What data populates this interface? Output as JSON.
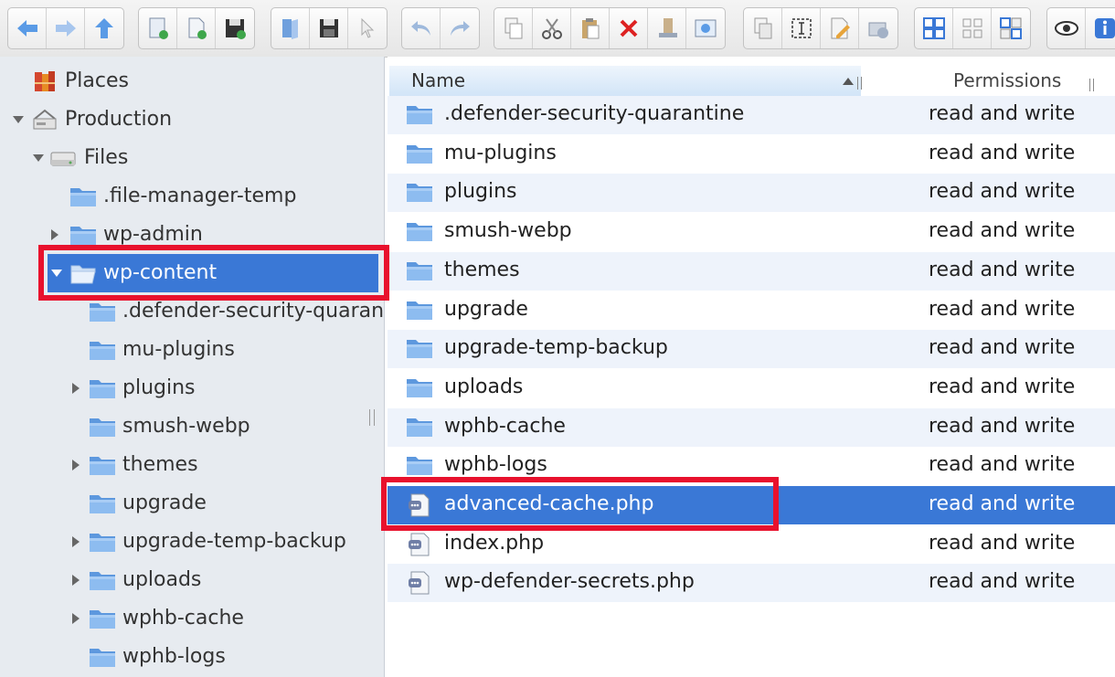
{
  "toolbar": {
    "groups": [
      [
        "back-icon",
        "forward-icon",
        "up-icon"
      ],
      [
        "new-folder-icon",
        "new-file-icon",
        "save-icon"
      ],
      [
        "open-icon",
        "disk-icon",
        "pointer-icon"
      ],
      [
        "undo-icon",
        "redo-icon"
      ],
      [
        "copy-icon",
        "cut-icon",
        "paste-icon",
        "delete-icon",
        "rename-icon",
        "edit-icon"
      ],
      [
        "duplicate-icon",
        "select-icon",
        "edit-text-icon",
        "permissions-icon"
      ],
      [
        "view-large-icon",
        "view-small-icon",
        "view-list-icon"
      ],
      [
        "preview-icon",
        "info-icon"
      ]
    ]
  },
  "sidebar": {
    "items": [
      {
        "label": "Places",
        "depth": 0,
        "arrow": "none",
        "icon": "places-icon"
      },
      {
        "label": "Production",
        "depth": 0,
        "arrow": "down",
        "icon": "server-icon"
      },
      {
        "label": "Files",
        "depth": 1,
        "arrow": "down",
        "icon": "drive-icon"
      },
      {
        "label": ".file-manager-temp",
        "depth": 2,
        "arrow": "none",
        "icon": "folder-icon"
      },
      {
        "label": "wp-admin",
        "depth": 2,
        "arrow": "right",
        "icon": "folder-icon"
      },
      {
        "label": "wp-content",
        "depth": 2,
        "arrow": "down",
        "icon": "open-folder-icon",
        "selected": true
      },
      {
        "label": ".defender-security-quarantine",
        "depth": 3,
        "arrow": "none",
        "icon": "folder-icon"
      },
      {
        "label": "mu-plugins",
        "depth": 3,
        "arrow": "none",
        "icon": "folder-icon"
      },
      {
        "label": "plugins",
        "depth": 3,
        "arrow": "right",
        "icon": "folder-icon"
      },
      {
        "label": "smush-webp",
        "depth": 3,
        "arrow": "none",
        "icon": "folder-icon"
      },
      {
        "label": "themes",
        "depth": 3,
        "arrow": "right",
        "icon": "folder-icon"
      },
      {
        "label": "upgrade",
        "depth": 3,
        "arrow": "none",
        "icon": "folder-icon"
      },
      {
        "label": "upgrade-temp-backup",
        "depth": 3,
        "arrow": "right",
        "icon": "folder-icon"
      },
      {
        "label": "uploads",
        "depth": 3,
        "arrow": "right",
        "icon": "folder-icon"
      },
      {
        "label": "wphb-cache",
        "depth": 3,
        "arrow": "right",
        "icon": "folder-icon"
      },
      {
        "label": "wphb-logs",
        "depth": 3,
        "arrow": "none",
        "icon": "folder-icon"
      }
    ]
  },
  "filelist": {
    "columns": {
      "name": "Name",
      "permissions": "Permissions"
    },
    "rows": [
      {
        "name": ".defender-security-quarantine",
        "perm": "read and write",
        "type": "folder"
      },
      {
        "name": "mu-plugins",
        "perm": "read and write",
        "type": "folder"
      },
      {
        "name": "plugins",
        "perm": "read and write",
        "type": "folder"
      },
      {
        "name": "smush-webp",
        "perm": "read and write",
        "type": "folder"
      },
      {
        "name": "themes",
        "perm": "read and write",
        "type": "folder"
      },
      {
        "name": "upgrade",
        "perm": "read and write",
        "type": "folder"
      },
      {
        "name": "upgrade-temp-backup",
        "perm": "read and write",
        "type": "folder"
      },
      {
        "name": "uploads",
        "perm": "read and write",
        "type": "folder"
      },
      {
        "name": "wphb-cache",
        "perm": "read and write",
        "type": "folder"
      },
      {
        "name": "wphb-logs",
        "perm": "read and write",
        "type": "folder"
      },
      {
        "name": "advanced-cache.php",
        "perm": "read and write",
        "type": "php",
        "selected": true
      },
      {
        "name": "index.php",
        "perm": "read and write",
        "type": "php"
      },
      {
        "name": "wp-defender-secrets.php",
        "perm": "read and write",
        "type": "php"
      }
    ]
  },
  "colors": {
    "selection": "#3a78d6",
    "highlight": "#e8112d",
    "folder": "#6fa8e6"
  }
}
